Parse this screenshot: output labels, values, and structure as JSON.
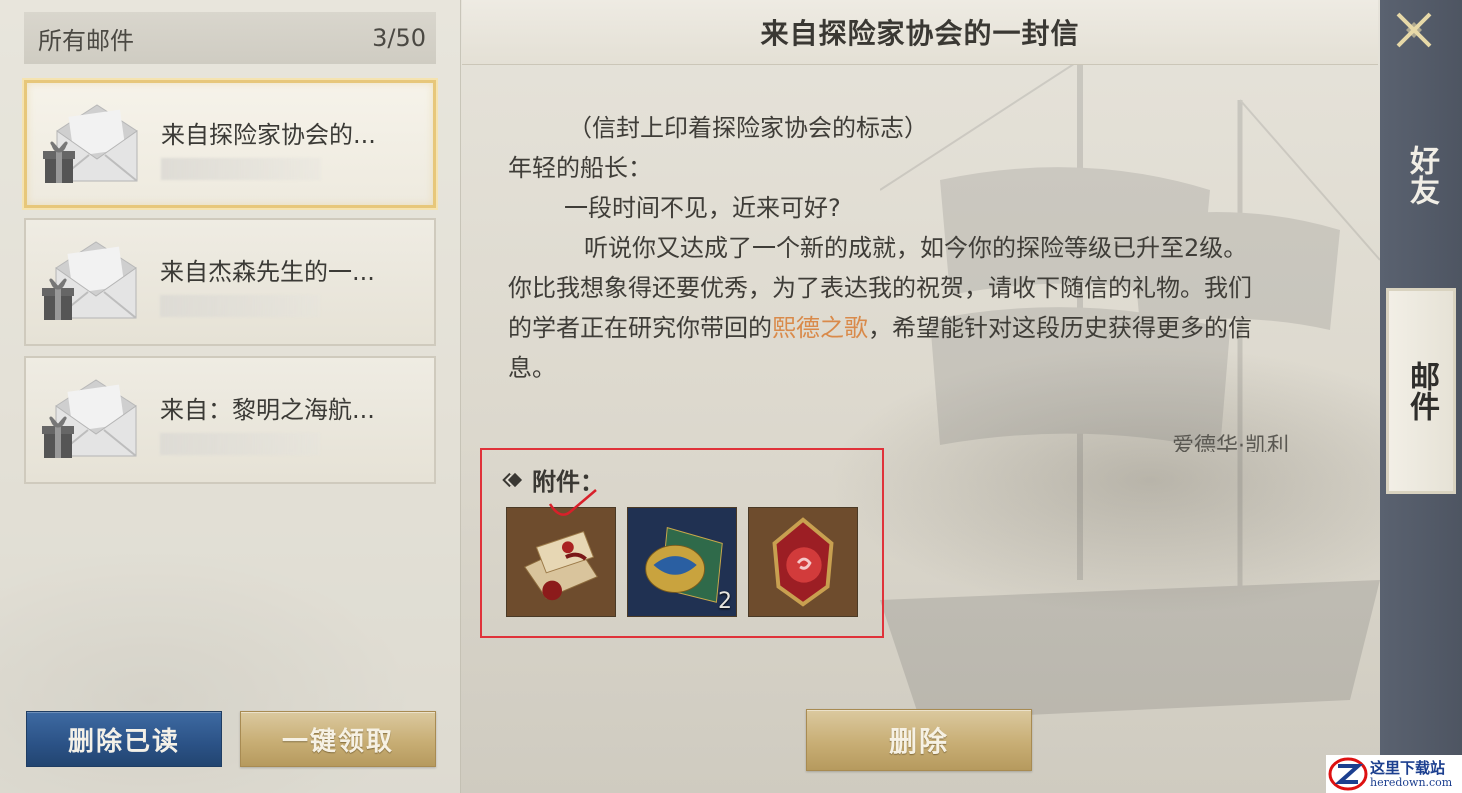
{
  "left_panel": {
    "header_label": "所有邮件",
    "mail_count": "3/50",
    "mails": [
      {
        "title": "来自探险家协会的...",
        "selected": true
      },
      {
        "title": "来自杰森先生的一...",
        "selected": false
      },
      {
        "title": "来自：黎明之海航...",
        "selected": false
      }
    ],
    "delete_read_label": "删除已读",
    "claim_all_label": "一键领取"
  },
  "mail": {
    "title": "来自探险家协会的一封信",
    "line1": "（信封上印着探险家协会的标志）",
    "line2": "年轻的船长：",
    "line3": "一段时间不见，近来可好?",
    "line4": "听说你又达成了一个新的成就，如今你的探险等级已升至2级。",
    "line5": "你比我想象得还要优秀，为了表达我的祝贺，请收下随信的礼物。我们",
    "line6_pre": "的学者正在研究你带回的",
    "line6_highlight": "熙德之歌",
    "line6_post": "，希望能针对这段历史获得更多的信",
    "line7": "息。",
    "signature": "爱德华·凯利",
    "highlight_color": "#d98a4a"
  },
  "attachments": {
    "label": "附件：",
    "items": [
      {
        "icon": "scroll-letter-icon",
        "count": ""
      },
      {
        "icon": "map-globe-icon",
        "count": "2"
      },
      {
        "icon": "red-gem-icon",
        "count": ""
      }
    ]
  },
  "delete_label": "删除",
  "right_nav": {
    "friends_label": "好友",
    "mail_label": "邮件"
  },
  "watermark": {
    "cn": "这里下载站",
    "en": "heredown.com"
  }
}
